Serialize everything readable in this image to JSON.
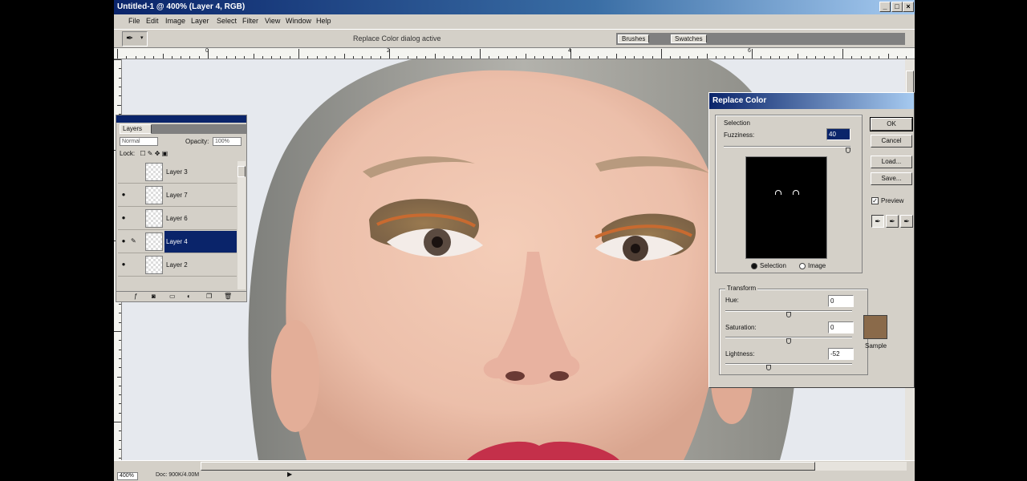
{
  "window": {
    "title": "Untitled-1 @ 400% (Layer 4, RGB)",
    "controls": {
      "minimize": "_",
      "maximize": "□",
      "close": "×"
    }
  },
  "menu": [
    "File",
    "Edit",
    "Image",
    "Layer",
    "Select",
    "Filter",
    "View",
    "Window",
    "Help"
  ],
  "options_bar": {
    "tool_icon": "eyedropper-icon",
    "hint": "Replace Color dialog active",
    "palette_tabs": [
      "Brushes",
      "Swatches"
    ]
  },
  "ruler": {
    "top_labels": [
      "0",
      "2",
      "4",
      "6"
    ]
  },
  "canvas": {
    "colors": {
      "skin": "#ecbfaa",
      "hair": "#9a9a94",
      "eyeshadow": "#8a6a45",
      "lips": "#c4304a",
      "background": "#e6e9ee"
    }
  },
  "layers_panel": {
    "tab": "Layers",
    "blend_mode": "Normal",
    "opacity_label": "Opacity:",
    "opacity_value": "100%",
    "lock_label": "Lock:",
    "layers": [
      {
        "name": "Layer 3",
        "visible": false,
        "selected": false
      },
      {
        "name": "Layer 7",
        "visible": true,
        "selected": false
      },
      {
        "name": "Layer 6",
        "visible": true,
        "selected": false
      },
      {
        "name": "Layer 4",
        "visible": true,
        "selected": true
      },
      {
        "name": "Layer 2",
        "visible": true,
        "selected": false
      }
    ]
  },
  "replace_color_dialog": {
    "title": "Replace Color",
    "selection": {
      "label": "Selection",
      "fuzziness_label": "Fuzziness:",
      "fuzziness_value": "40",
      "fuzziness_level": 0.98,
      "radio_selection": "Selection",
      "radio_image": "Image",
      "selected_radio": "Selection"
    },
    "buttons": {
      "ok": "OK",
      "cancel": "Cancel",
      "load": "Load...",
      "save": "Save..."
    },
    "preview_label": "Preview",
    "preview_checked": true,
    "transform": {
      "label": "Transform",
      "hue_label": "Hue:",
      "hue_value": "0",
      "hue_level": 0.5,
      "saturation_label": "Saturation:",
      "saturation_value": "0",
      "saturation_level": 0.5,
      "lightness_label": "Lightness:",
      "lightness_value": "-52",
      "lightness_level": 0.34,
      "sample_label": "Sample",
      "sample_color": "#8a6a4a"
    }
  },
  "status": {
    "zoom": "400%",
    "doc": "Doc: 900K/4.00M"
  }
}
